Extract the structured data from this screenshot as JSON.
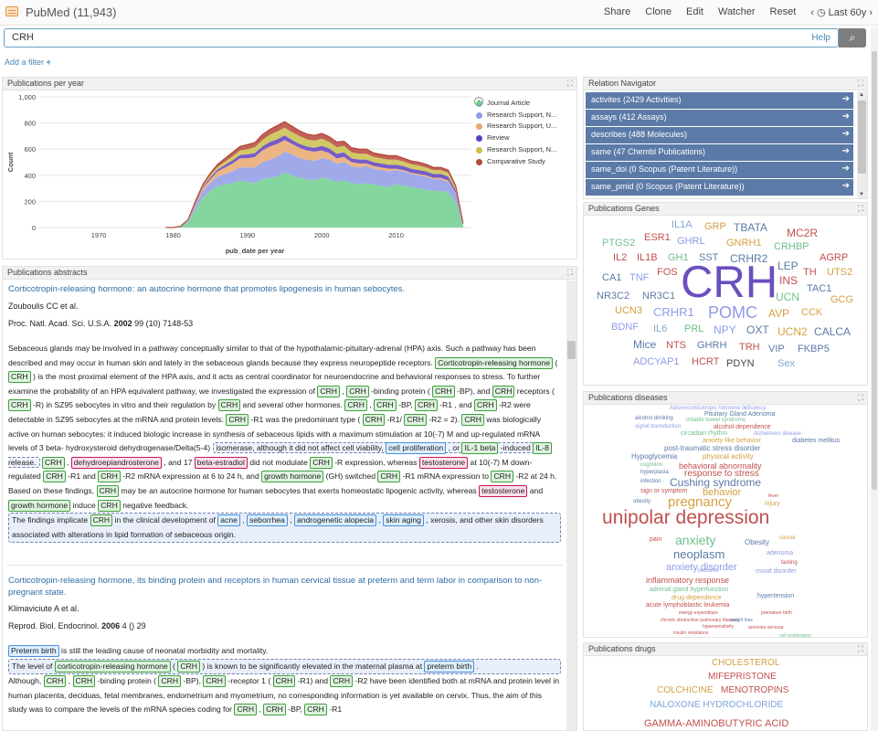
{
  "app": {
    "title": "PubMed (11,943)"
  },
  "nav": {
    "share": "Share",
    "clone": "Clone",
    "edit": "Edit",
    "watcher": "Watcher",
    "reset": "Reset",
    "period": "Last 60y"
  },
  "search": {
    "value": "CRH",
    "help": "Help"
  },
  "add_filter": "Add a filter",
  "pub_year": {
    "title": "Publications per year",
    "legend": [
      "Journal Article",
      "Research Support, N...",
      "Research Support, U...",
      "Review",
      "Research Support, N...",
      "Comparative Study"
    ],
    "legend_colors": [
      "#6fcf8d",
      "#8f9be6",
      "#e9a86f",
      "#5e3fbf",
      "#c9c04a",
      "#b5473a"
    ]
  },
  "chart_data": {
    "type": "area",
    "xlabel": "pub_date per year",
    "ylabel": "Count",
    "ylim": [
      0,
      1000
    ],
    "yticks": [
      "1,000",
      "800",
      "600",
      "400",
      "200",
      "0"
    ],
    "xticks": [
      "1970",
      "1980",
      "1990",
      "2000",
      "2010"
    ],
    "x": [
      1979,
      1980,
      1981,
      1982,
      1983,
      1984,
      1985,
      1986,
      1987,
      1988,
      1989,
      1990,
      1991,
      1992,
      1993,
      1994,
      1995,
      1996,
      1997,
      1998,
      1999,
      2000,
      2001,
      2002,
      2003,
      2004,
      2005,
      2006,
      2007,
      2008,
      2009,
      2010,
      2011,
      2012,
      2013,
      2014,
      2015,
      2016,
      2017,
      2018,
      2019
    ],
    "series": [
      {
        "name": "Journal Article",
        "values": [
          0,
          0,
          10,
          40,
          140,
          230,
          280,
          320,
          330,
          340,
          360,
          350,
          340,
          370,
          380,
          390,
          420,
          400,
          380,
          370,
          360,
          380,
          370,
          350,
          360,
          340,
          330,
          340,
          330,
          320,
          310,
          330,
          320,
          310,
          300,
          290,
          280,
          280,
          270,
          200,
          20
        ]
      },
      {
        "name": "Research Support, N...",
        "values": [
          0,
          0,
          0,
          10,
          30,
          50,
          60,
          70,
          80,
          90,
          100,
          110,
          120,
          130,
          140,
          150,
          160,
          160,
          150,
          150,
          150,
          150,
          150,
          140,
          140,
          130,
          130,
          130,
          120,
          120,
          120,
          110,
          110,
          100,
          100,
          100,
          90,
          90,
          80,
          60,
          5
        ]
      },
      {
        "name": "Research Support, U...",
        "values": [
          0,
          0,
          0,
          5,
          10,
          20,
          30,
          40,
          50,
          60,
          70,
          70,
          80,
          90,
          100,
          100,
          90,
          80,
          80,
          70,
          70,
          60,
          50,
          40,
          40,
          30,
          30,
          20,
          20,
          20,
          20,
          10,
          10,
          10,
          10,
          10,
          10,
          10,
          10,
          5,
          0
        ]
      },
      {
        "name": "Review",
        "values": [
          0,
          0,
          0,
          5,
          10,
          10,
          15,
          15,
          20,
          25,
          25,
          30,
          30,
          30,
          35,
          35,
          35,
          30,
          30,
          30,
          30,
          35,
          35,
          35,
          35,
          30,
          30,
          30,
          30,
          30,
          30,
          30,
          30,
          30,
          30,
          30,
          30,
          30,
          30,
          20,
          2
        ]
      },
      {
        "name": "Research Support, N...",
        "values": [
          0,
          0,
          0,
          0,
          5,
          10,
          15,
          20,
          25,
          30,
          35,
          40,
          45,
          50,
          55,
          60,
          60,
          60,
          60,
          55,
          55,
          55,
          50,
          50,
          50,
          45,
          45,
          45,
          40,
          40,
          40,
          40,
          35,
          35,
          35,
          30,
          30,
          30,
          30,
          20,
          2
        ]
      },
      {
        "name": "Comparative Study",
        "values": [
          0,
          0,
          0,
          0,
          5,
          10,
          15,
          20,
          25,
          30,
          30,
          35,
          35,
          40,
          40,
          45,
          45,
          45,
          40,
          40,
          40,
          40,
          40,
          40,
          35,
          35,
          35,
          35,
          30,
          30,
          30,
          30,
          25,
          25,
          25,
          25,
          20,
          20,
          20,
          15,
          2
        ]
      }
    ]
  },
  "abstracts": {
    "title": "Publications abstracts",
    "a1": {
      "title": "Corticotropin-releasing hormone: an autocrine hormone that promotes lipogenesis in human sebocytes.",
      "authors": "Zouboulis CC et al.",
      "journal": "Proc. Natl. Acad. Sci. U.S.A.",
      "year": "2002",
      "vol": "99",
      "issue_pages": "(10) 7148-53"
    },
    "a2": {
      "title": "Corticotropin-releasing hormone, its binding protein and receptors in human cervical tissue at preterm and term labor in comparison to non-pregnant state.",
      "authors": "Klimaviciute A et al.",
      "journal": "Reprod. Biol. Endocrinol.",
      "year": "2006",
      "vol": "4",
      "issue_pages": "() 29"
    }
  },
  "relation_nav": {
    "title": "Relation Navigator",
    "items": [
      "activites (2429 Activities)",
      "assays (412 Assays)",
      "describes (488 Molecules)",
      "same (47 Chembl Publications)",
      "same_doi (0 Scopus (Patent Literature))",
      "same_pmid (0 Scopus (Patent Literature))"
    ]
  },
  "genes": {
    "title": "Publications Genes"
  },
  "diseases": {
    "title": "Publications diseases"
  },
  "drugs": {
    "title": "Publications drugs"
  },
  "gene_cloud": [
    "IL1A",
    "GRP",
    "TBATA",
    "MC2R",
    "PTGS2",
    "ESR1",
    "GHRL",
    "GNRH1",
    "CRHBP",
    "IL2",
    "IL1B",
    "GH1",
    "SST",
    "CRHR2",
    "AGRP",
    "LEP",
    "TH",
    "UTS2",
    "CA1",
    "TNF",
    "FOS",
    "CRH",
    "INS",
    "NR3C2",
    "NR3C1",
    "UCN",
    "TAC1",
    "GCG",
    "UCN3",
    "CRHR1",
    "POMC",
    "AVP",
    "CCK",
    "BDNF",
    "IL6",
    "PRL",
    "NPY",
    "OXT",
    "UCN2",
    "CALCA",
    "Mice",
    "NTS",
    "GHRH",
    "TRH",
    "VIP",
    "FKBP5",
    "ADCYAP1",
    "HCRT",
    "PDYN",
    "Sex"
  ],
  "disease_cloud": [
    "Adrenocorticotropic hormone deficiency",
    "Pituitary Gland Adenoma",
    "alcohol drinking",
    "irritable bowel syndrome",
    "signal transduction",
    "alcohol dependence",
    "circadian rhythm",
    "Alzheimers disease",
    "anxiety-like behavior",
    "diabetes mellitus",
    "post-traumatic stress disorder",
    "Hypoglycemia",
    "physical activity",
    "cognition",
    "behavioral abnormality",
    "hyperplasia",
    "response to stress",
    "infection",
    "Cushing syndrome",
    "sign or symptom",
    "behavior",
    "fever",
    "obesity",
    "pregnancy",
    "injury",
    "unipolar depression",
    "pain",
    "anxiety",
    "cancer",
    "Obesity",
    "neoplasm",
    "adenoma",
    "anxiety disorder",
    "fasting",
    "Seizures",
    "mood disorder",
    "inflammatory response",
    "adrenal gland hyperfunction",
    "drug dependence",
    "hypertension",
    "acute lymphoblastic leukemia",
    "energy expenditure",
    "premature birth",
    "chronic obstructive pulmonary disease",
    "weight loss",
    "hypersensitivity",
    "anorexia nervosa",
    "insulin resistance",
    "cell proliferation",
    "body weight gain"
  ],
  "drug_cloud": [
    "CHOLESTEROL",
    "MIFEPRISTONE",
    "COLCHICINE",
    "MENOTROPINS",
    "NALOXONE HYDROCHLORIDE",
    "GAMMA-AMINOBUTYRIC ACID"
  ]
}
